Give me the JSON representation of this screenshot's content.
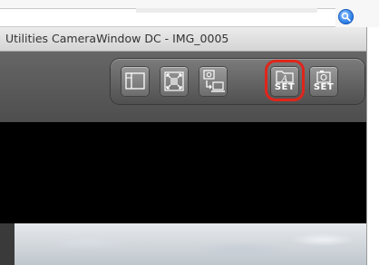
{
  "window": {
    "title": "Utilities CameraWindow DC - IMG_0005"
  },
  "search": {
    "icon": "magnifier-icon"
  },
  "toolbar": {
    "buttons": [
      {
        "name": "layout-view-button",
        "icon": "layout-icon",
        "label": ""
      },
      {
        "name": "fullscreen-button",
        "icon": "fullscreen-arrows-icon",
        "label": ""
      },
      {
        "name": "import-from-camera-button",
        "icon": "camera-to-computer-icon",
        "label": ""
      },
      {
        "name": "auto-set-button",
        "icon": "auto-folder-icon",
        "label": "SET"
      },
      {
        "name": "camera-set-button",
        "icon": "camera-icon",
        "label": "SET"
      }
    ],
    "highlight_color": "#e0251b"
  }
}
